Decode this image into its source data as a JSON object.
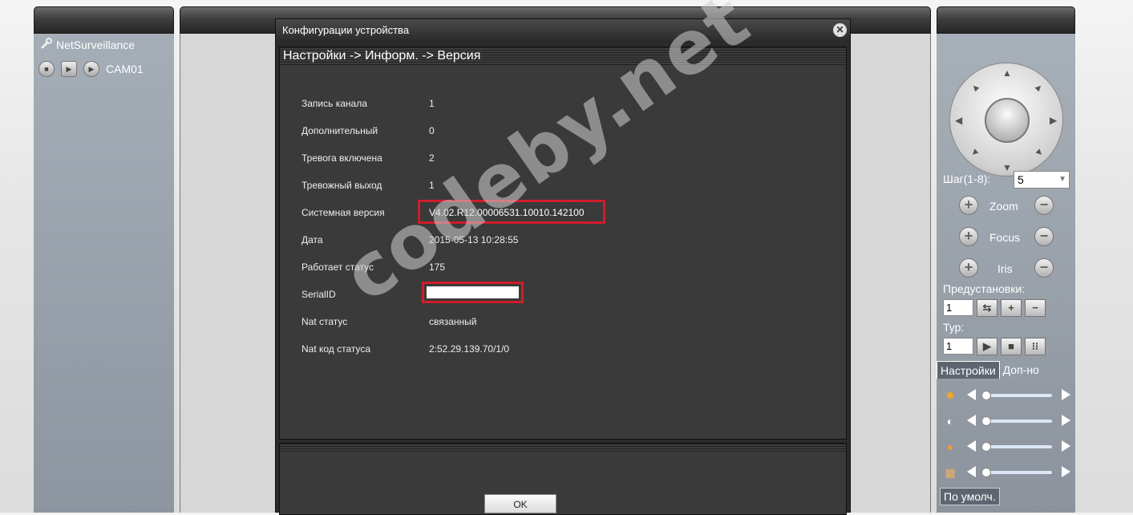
{
  "left_panel": {
    "title": "NetSurveillance",
    "camera": "CAM01"
  },
  "dialog": {
    "title": "Конфигурации устройства",
    "header": "Настройки -> Информ. -> Версия",
    "rows": [
      {
        "label": "Запись канала",
        "value": "1"
      },
      {
        "label": "Дополнительный",
        "value": "0"
      },
      {
        "label": "Тревога включена",
        "value": "2"
      },
      {
        "label": "Тревожный выход",
        "value": "1"
      },
      {
        "label": "Системная версия",
        "value": "V4.02.R12.00006531.10010.142100"
      },
      {
        "label": "Дата",
        "value": "2015-05-13 10:28:55"
      },
      {
        "label": "Работает статус",
        "value": "175"
      },
      {
        "label": "SerialID",
        "value": ""
      },
      {
        "label": "Nat статус",
        "value": "связанный"
      },
      {
        "label": "Nat код статуса",
        "value": "2:52.29.139.70/1/0"
      }
    ],
    "ok_label": "OK",
    "highlight_color": "#d01c2a"
  },
  "right_panel": {
    "step_label": "Шаг(1-8):",
    "step_value": "5",
    "zoom_label": "Zoom",
    "focus_label": "Focus",
    "iris_label": "Iris",
    "presets_label": "Предустановки:",
    "preset_value": "1",
    "tour_label": "Тур:",
    "tour_value": "1",
    "tab_settings": "Настройки",
    "tab_extra": "Доп-но",
    "default_label": "По умолч."
  },
  "watermark": "codeby.net"
}
